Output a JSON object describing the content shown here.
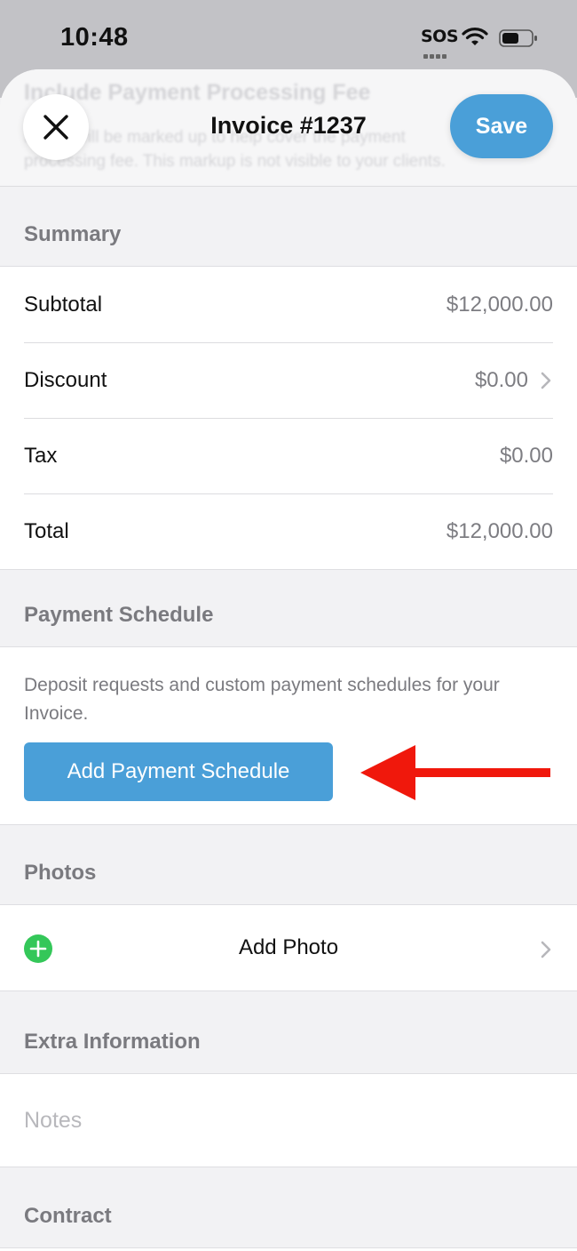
{
  "status_bar": {
    "time": "10:48",
    "sos": "SOS"
  },
  "header": {
    "title": "Invoice #1237",
    "save_label": "Save",
    "behind_title": "Include Payment Processing Fee",
    "behind_line1": "Prices will be marked up to help cover the payment",
    "behind_line2": "processing fee. This markup is not visible to your clients."
  },
  "summary": {
    "header": "Summary",
    "rows": [
      {
        "label": "Subtotal",
        "value": "$12,000.00"
      },
      {
        "label": "Discount",
        "value": "$0.00"
      },
      {
        "label": "Tax",
        "value": "$0.00"
      },
      {
        "label": "Total",
        "value": "$12,000.00"
      }
    ]
  },
  "payment_schedule": {
    "header": "Payment Schedule",
    "description": "Deposit requests and custom payment schedules for your Invoice.",
    "button_label": "Add Payment Schedule"
  },
  "photos": {
    "header": "Photos",
    "add_label": "Add Photo"
  },
  "extra_information": {
    "header": "Extra Information",
    "notes_placeholder": "Notes"
  },
  "contract": {
    "header": "Contract"
  },
  "colors": {
    "accent": "#4a9fd8",
    "add_icon": "#34c759",
    "annotation_arrow": "#f0180c"
  },
  "icons": [
    "close-icon",
    "chevron-right-icon",
    "plus-circle-icon",
    "wifi-icon",
    "battery-icon",
    "annotation-arrow"
  ]
}
